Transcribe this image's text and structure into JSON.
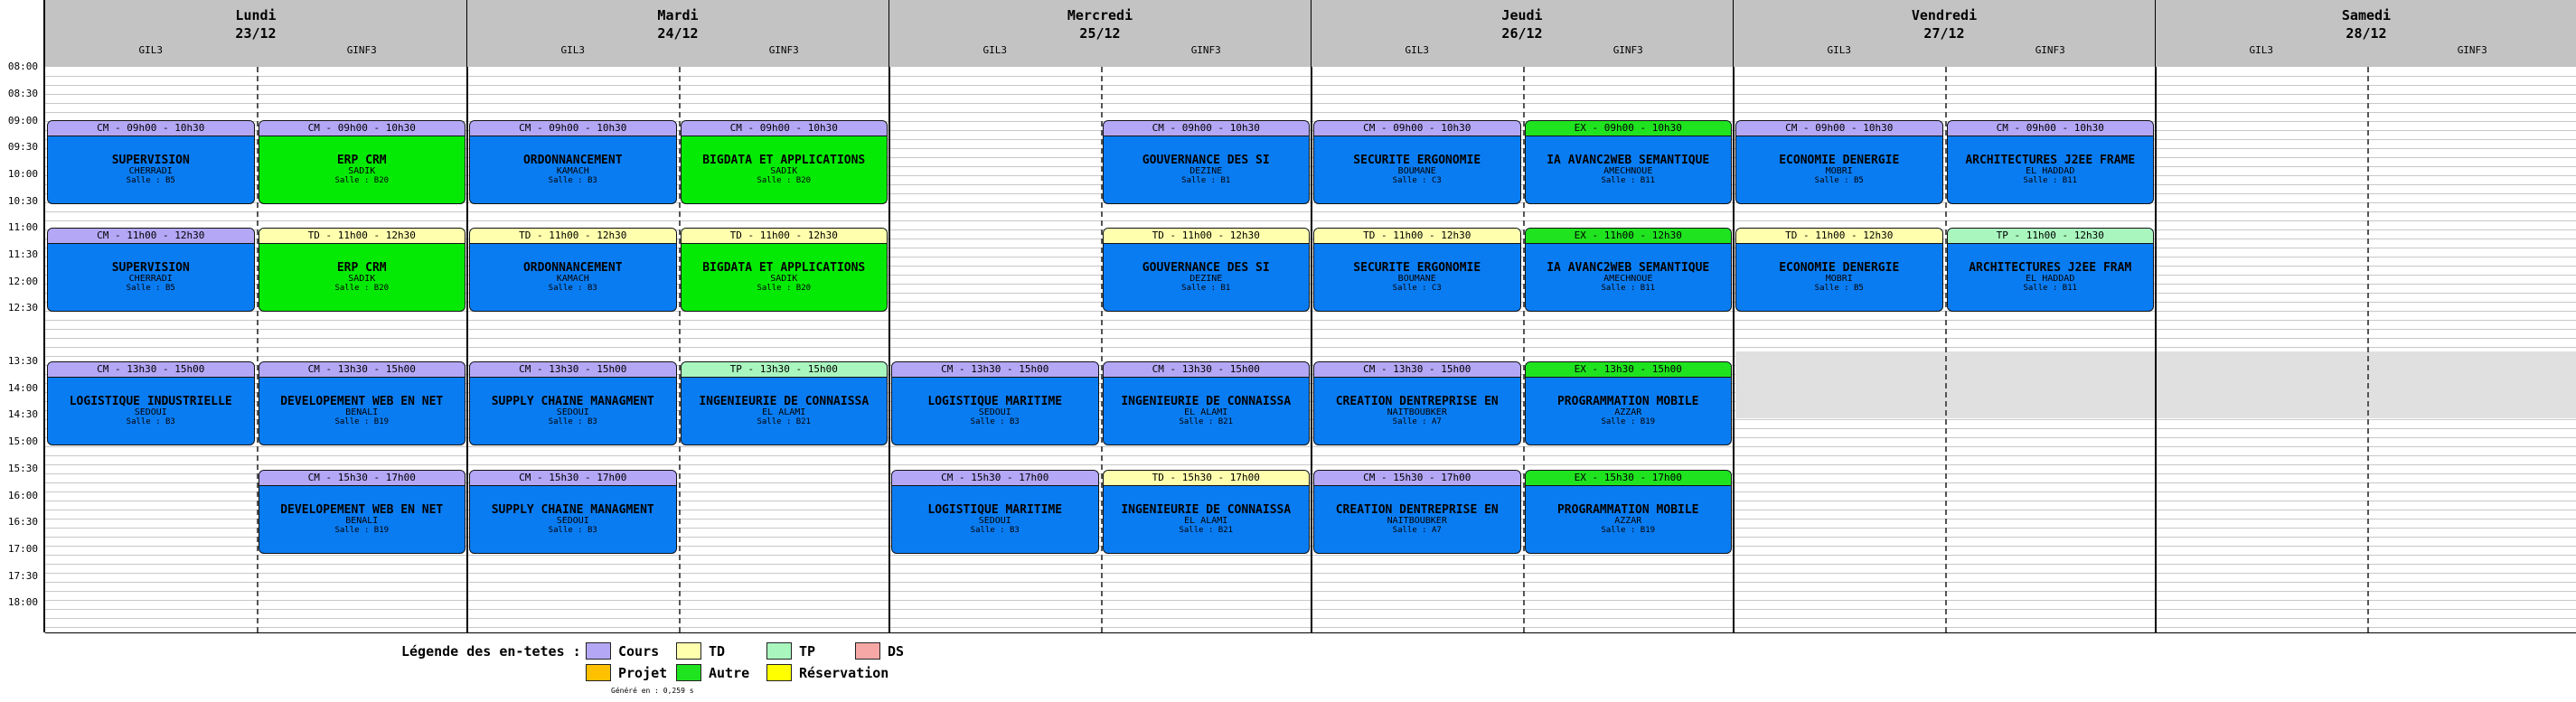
{
  "colors": {
    "cm": "#b4a7f6",
    "td": "#ffffae",
    "tp": "#a9f7bf",
    "ex": "#1fe31f",
    "green_body": "#05ea05",
    "blue_body": "#0a7cf2",
    "header_bg": "#c3c3c3",
    "ds": "#f6a8a6",
    "projet": "#ffc000",
    "reservation": "#ffff00"
  },
  "hours": [
    "08:00",
    "08:30",
    "09:00",
    "09:30",
    "10:00",
    "10:30",
    "11:00",
    "11:30",
    "12:00",
    "12:30",
    "13:30",
    "14:00",
    "14:30",
    "15:00",
    "15:30",
    "16:00",
    "16:30",
    "17:00",
    "17:30",
    "18:00"
  ],
  "days": [
    {
      "name": "Lundi",
      "date": "23/12",
      "groups": [
        "GIL3",
        "GINF3"
      ]
    },
    {
      "name": "Mardi",
      "date": "24/12",
      "groups": [
        "GIL3",
        "GINF3"
      ]
    },
    {
      "name": "Mercredi",
      "date": "25/12",
      "groups": [
        "GIL3",
        "GINF3"
      ]
    },
    {
      "name": "Jeudi",
      "date": "26/12",
      "groups": [
        "GIL3",
        "GINF3"
      ]
    },
    {
      "name": "Vendredi",
      "date": "27/12",
      "groups": [
        "GIL3",
        "GINF3"
      ]
    },
    {
      "name": "Samedi",
      "date": "28/12",
      "groups": [
        "GIL3",
        "GINF3"
      ]
    }
  ],
  "events": [
    {
      "day": 0,
      "group": 0,
      "slot": 0,
      "type": "cm",
      "header": "CM - 09h00 - 10h30",
      "title": "SUPERVISION",
      "teacher": "CHERRADI",
      "room": "Salle : B5",
      "green": false
    },
    {
      "day": 0,
      "group": 0,
      "slot": 1,
      "type": "cm",
      "header": "CM - 11h00 - 12h30",
      "title": "SUPERVISION",
      "teacher": "CHERRADI",
      "room": "Salle : B5",
      "green": false
    },
    {
      "day": 0,
      "group": 0,
      "slot": 2,
      "type": "cm",
      "header": "CM - 13h30 - 15h00",
      "title": "LOGISTIQUE INDUSTRIELLE",
      "teacher": "SEDOUI",
      "room": "Salle : B3",
      "green": false
    },
    {
      "day": 0,
      "group": 1,
      "slot": 0,
      "type": "cm",
      "header": "CM - 09h00 - 10h30",
      "title": "ERP CRM",
      "teacher": "SADIK",
      "room": "Salle : B20",
      "green": true
    },
    {
      "day": 0,
      "group": 1,
      "slot": 1,
      "type": "td",
      "header": "TD - 11h00 - 12h30",
      "title": "ERP CRM",
      "teacher": "SADIK",
      "room": "Salle : B20",
      "green": true
    },
    {
      "day": 0,
      "group": 1,
      "slot": 2,
      "type": "cm",
      "header": "CM - 13h30 - 15h00",
      "title": "DEVELOPEMENT WEB EN NET",
      "teacher": "BENALI",
      "room": "Salle : B19",
      "green": false
    },
    {
      "day": 0,
      "group": 1,
      "slot": 3,
      "type": "cm",
      "header": "CM - 15h30 - 17h00",
      "title": "DEVELOPEMENT WEB EN NET",
      "teacher": "BENALI",
      "room": "Salle : B19",
      "green": false
    },
    {
      "day": 1,
      "group": 0,
      "slot": 0,
      "type": "cm",
      "header": "CM - 09h00 - 10h30",
      "title": "ORDONNANCEMENT",
      "teacher": "KAMACH",
      "room": "Salle : B3",
      "green": false
    },
    {
      "day": 1,
      "group": 0,
      "slot": 1,
      "type": "td",
      "header": "TD - 11h00 - 12h30",
      "title": "ORDONNANCEMENT",
      "teacher": "KAMACH",
      "room": "Salle : B3",
      "green": false
    },
    {
      "day": 1,
      "group": 0,
      "slot": 2,
      "type": "cm",
      "header": "CM - 13h30 - 15h00",
      "title": "SUPPLY CHAINE MANAGMENT",
      "teacher": "SEDOUI",
      "room": "Salle : B3",
      "green": false
    },
    {
      "day": 1,
      "group": 0,
      "slot": 3,
      "type": "cm",
      "header": "CM - 15h30 - 17h00",
      "title": "SUPPLY CHAINE MANAGMENT",
      "teacher": "SEDOUI",
      "room": "Salle : B3",
      "green": false
    },
    {
      "day": 1,
      "group": 1,
      "slot": 0,
      "type": "cm",
      "header": "CM - 09h00 - 10h30",
      "title": "BIGDATA ET APPLICATIONS",
      "teacher": "SADIK",
      "room": "Salle : B20",
      "green": true
    },
    {
      "day": 1,
      "group": 1,
      "slot": 1,
      "type": "td",
      "header": "TD - 11h00 - 12h30",
      "title": "BIGDATA ET APPLICATIONS",
      "teacher": "SADIK",
      "room": "Salle : B20",
      "green": true
    },
    {
      "day": 1,
      "group": 1,
      "slot": 2,
      "type": "tp",
      "header": "TP - 13h30 - 15h00",
      "title": "INGENIEURIE DE CONNAISSA",
      "teacher": "EL ALAMI",
      "room": "Salle : B21",
      "green": false
    },
    {
      "day": 2,
      "group": 0,
      "slot": 2,
      "type": "cm",
      "header": "CM - 13h30 - 15h00",
      "title": "LOGISTIQUE MARITIME",
      "teacher": "SEDOUI",
      "room": "Salle : B3",
      "green": false
    },
    {
      "day": 2,
      "group": 0,
      "slot": 3,
      "type": "cm",
      "header": "CM - 15h30 - 17h00",
      "title": "LOGISTIQUE MARITIME",
      "teacher": "SEDOUI",
      "room": "Salle : B3",
      "green": false
    },
    {
      "day": 2,
      "group": 1,
      "slot": 0,
      "type": "cm",
      "header": "CM - 09h00 - 10h30",
      "title": "GOUVERNANCE DES SI",
      "teacher": "DEZINE",
      "room": "Salle : B1",
      "green": false
    },
    {
      "day": 2,
      "group": 1,
      "slot": 1,
      "type": "td",
      "header": "TD - 11h00 - 12h30",
      "title": "GOUVERNANCE DES SI",
      "teacher": "DEZINE",
      "room": "Salle : B1",
      "green": false
    },
    {
      "day": 2,
      "group": 1,
      "slot": 2,
      "type": "cm",
      "header": "CM - 13h30 - 15h00",
      "title": "INGENIEURIE DE CONNAISSA",
      "teacher": "EL ALAMI",
      "room": "Salle : B21",
      "green": false
    },
    {
      "day": 2,
      "group": 1,
      "slot": 3,
      "type": "td",
      "header": "TD - 15h30 - 17h00",
      "title": "INGENIEURIE DE CONNAISSA",
      "teacher": "EL ALAMI",
      "room": "Salle : B21",
      "green": false
    },
    {
      "day": 3,
      "group": 0,
      "slot": 0,
      "type": "cm",
      "header": "CM - 09h00 - 10h30",
      "title": "SECURITE ERGONOMIE",
      "teacher": "BOUMANE",
      "room": "Salle : C3",
      "green": false
    },
    {
      "day": 3,
      "group": 0,
      "slot": 1,
      "type": "td",
      "header": "TD - 11h00 - 12h30",
      "title": "SECURITE ERGONOMIE",
      "teacher": "BOUMANE",
      "room": "Salle : C3",
      "green": false
    },
    {
      "day": 3,
      "group": 0,
      "slot": 2,
      "type": "cm",
      "header": "CM - 13h30 - 15h00",
      "title": "CREATION DENTREPRISE EN",
      "teacher": "NAITBOUBKER",
      "room": "Salle : A7",
      "green": false
    },
    {
      "day": 3,
      "group": 0,
      "slot": 3,
      "type": "cm",
      "header": "CM - 15h30 - 17h00",
      "title": "CREATION DENTREPRISE EN",
      "teacher": "NAITBOUBKER",
      "room": "Salle : A7",
      "green": false
    },
    {
      "day": 3,
      "group": 1,
      "slot": 0,
      "type": "ex",
      "header": "EX - 09h00 - 10h30",
      "title": "IA AVANC2WEB SEMANTIQUE",
      "teacher": "AMECHNOUE",
      "room": "Salle : B11",
      "green": false
    },
    {
      "day": 3,
      "group": 1,
      "slot": 1,
      "type": "ex",
      "header": "EX - 11h00 - 12h30",
      "title": "IA AVANC2WEB SEMANTIQUE",
      "teacher": "AMECHNOUE",
      "room": "Salle : B11",
      "green": false
    },
    {
      "day": 3,
      "group": 1,
      "slot": 2,
      "type": "ex",
      "header": "EX - 13h30 - 15h00",
      "title": "PROGRAMMATION MOBILE",
      "teacher": "AZZAR",
      "room": "Salle : B19",
      "green": false
    },
    {
      "day": 3,
      "group": 1,
      "slot": 3,
      "type": "ex",
      "header": "EX - 15h30 - 17h00",
      "title": "PROGRAMMATION MOBILE",
      "teacher": "AZZAR",
      "room": "Salle : B19",
      "green": false
    },
    {
      "day": 4,
      "group": 0,
      "slot": 0,
      "type": "cm",
      "header": "CM - 09h00 - 10h30",
      "title": "ECONOMIE DENERGIE",
      "teacher": "MOBRI",
      "room": "Salle : B5",
      "green": false
    },
    {
      "day": 4,
      "group": 0,
      "slot": 1,
      "type": "td",
      "header": "TD - 11h00 - 12h30",
      "title": "ECONOMIE DENERGIE",
      "teacher": "MOBRI",
      "room": "Salle : B5",
      "green": false
    },
    {
      "day": 4,
      "group": 1,
      "slot": 0,
      "type": "cm",
      "header": "CM - 09h00 - 10h30",
      "title": "ARCHITECTURES J2EE FRAME",
      "teacher": "EL HADDAD",
      "room": "Salle : B11",
      "green": false
    },
    {
      "day": 4,
      "group": 1,
      "slot": 1,
      "type": "tp",
      "header": "TP - 11h00 - 12h30",
      "title": "ARCHITECTURES J2EE FRAM",
      "teacher": "EL HADDAD",
      "room": "Salle : B11",
      "green": false
    }
  ],
  "legend": {
    "title": "Légende des en-tetes :",
    "items": [
      {
        "label": "Cours",
        "color": "#b4a7f6"
      },
      {
        "label": "TD",
        "color": "#ffffae"
      },
      {
        "label": "TP",
        "color": "#a9f7bf"
      },
      {
        "label": "DS",
        "color": "#f6a8a6"
      },
      {
        "label": "Projet",
        "color": "#ffc000"
      },
      {
        "label": "Autre",
        "color": "#1fe31f"
      },
      {
        "label": "Réservation",
        "color": "#ffff00"
      }
    ]
  },
  "footer": "Généré en : 0,259 s"
}
